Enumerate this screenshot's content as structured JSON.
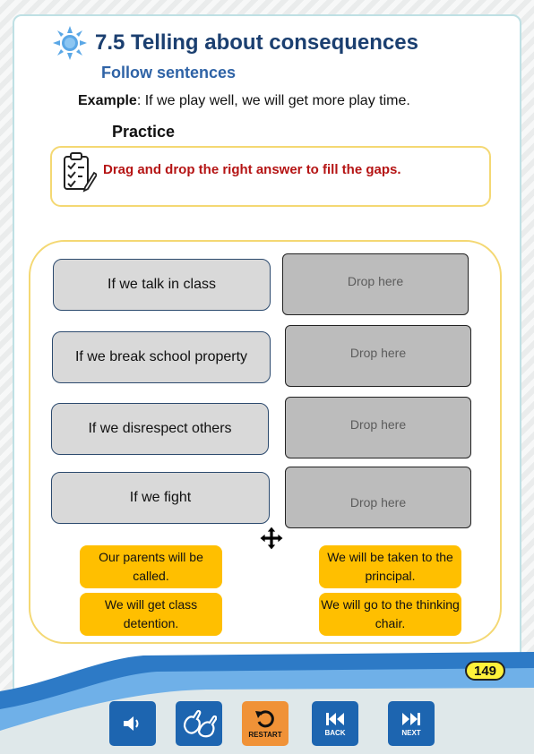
{
  "header": {
    "title": "7.5 Telling about consequences",
    "subtitle": "Follow sentences",
    "example_label": "Example",
    "example_text": ":  If we play well, we will get more play time.",
    "practice": "Practice"
  },
  "instruction": "Drag and drop the right answer to fill the gaps.",
  "prompts": [
    "If we talk in class",
    "If we break school property",
    "If we disrespect others",
    "If we fight"
  ],
  "drop_placeholder": "Drop here",
  "answers": [
    "Our parents will be called.",
    "We will be taken to the principal.",
    "We will get class detention.",
    "We will go to the thinking chair."
  ],
  "page_number": "149",
  "controls": {
    "restart": "RESTART",
    "back": "BACK",
    "next": "NEXT"
  },
  "colors": {
    "title": "#1b3f70",
    "subtitle": "#2f63a6",
    "instruction": "#b51414",
    "answer_chip": "#ffbf00",
    "nav_blue": "#1d65b0",
    "nav_orange": "#f09237"
  }
}
